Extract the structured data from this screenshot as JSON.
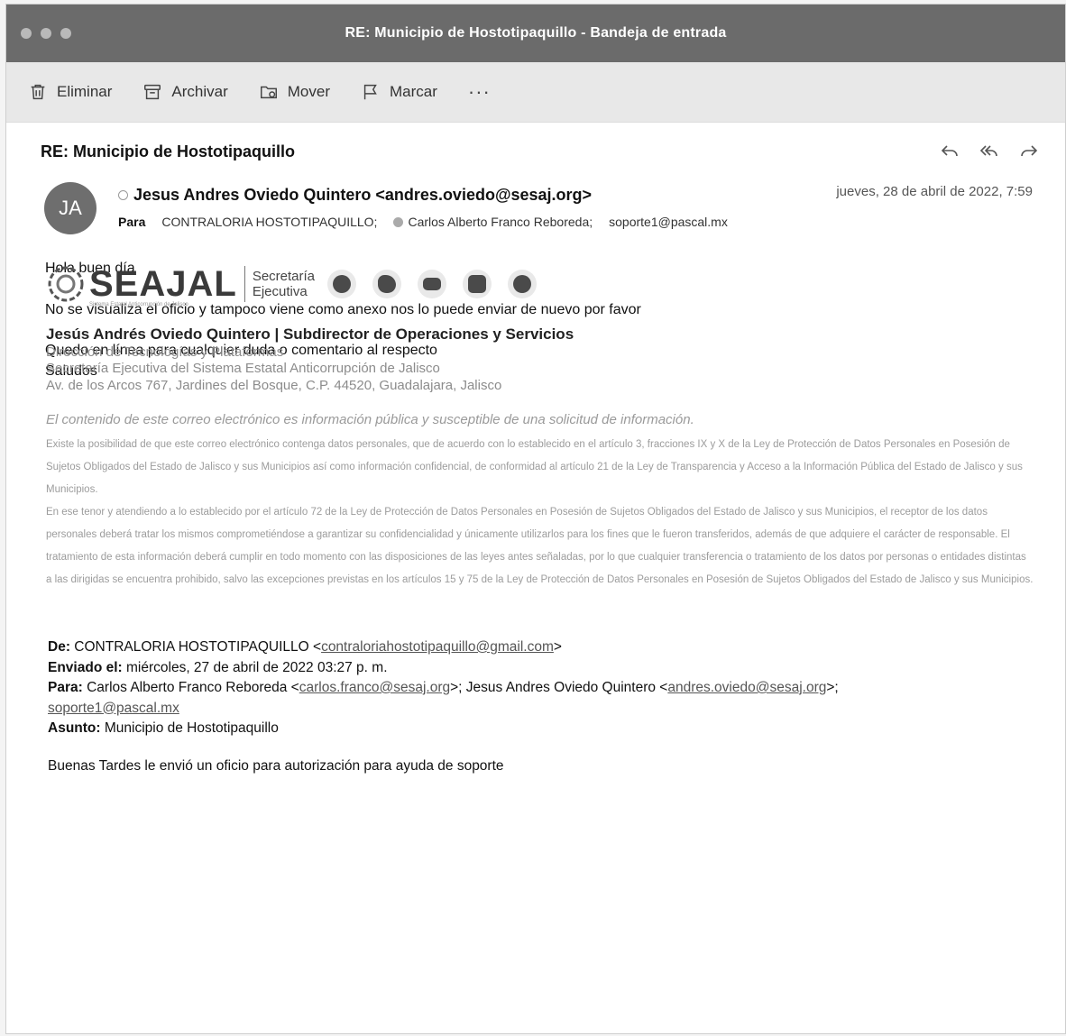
{
  "window": {
    "title": "RE: Municipio de Hostotipaquillo - Bandeja de entrada"
  },
  "toolbar": {
    "delete_label": "Eliminar",
    "archive_label": "Archivar",
    "move_label": "Mover",
    "flag_label": "Marcar",
    "more_label": "···"
  },
  "message": {
    "subject": "RE: Municipio de Hostotipaquillo",
    "avatar_initials": "JA",
    "sender": "Jesus Andres Oviedo Quintero <andres.oviedo@sesaj.org>",
    "date": "jueves, 28 de abril de 2022, 7:59",
    "to_label": "Para",
    "recipients": [
      "CONTRALORIA HOSTOTIPAQUILLO;",
      "Carlos Alberto Franco Reboreda;",
      "soporte1@pascal.mx"
    ],
    "body": [
      "Hola buen día",
      "No se visualiza el oficio y tampoco viene como anexo nos lo puede enviar de nuevo por favor",
      "Quedo en línea para cualquier duda o comentario al respecto",
      "Saludos"
    ]
  },
  "signature": {
    "logo_text": "SEAJAL",
    "logo_subtext": "Sistema Estatal Anticorrupción de Jalisco",
    "side_line1": "Secretaría",
    "side_line2": "Ejecutiva",
    "social_icons": [
      "facebook-icon",
      "twitter-icon",
      "youtube-icon",
      "instagram-icon",
      "location-icon"
    ],
    "name_title": "Jesús Andrés Oviedo Quintero | Subdirector de Operaciones y Servicios",
    "line1": "Dirección de Tecnologías y Plataformas",
    "line2": "Secretaría Ejecutiva del Sistema Estatal Anticorrupción de Jalisco",
    "line3": "Av. de los Arcos 767, Jardines del Bosque, C.P. 44520, Guadalajara, Jalisco"
  },
  "disclaimer": {
    "title": "El contenido de este correo electrónico es información pública y susceptible de una solicitud de información.",
    "p1": "Existe la posibilidad de que este correo electrónico contenga datos personales, que de acuerdo con lo establecido en el artículo 3, fracciones IX y X de la Ley de Protección de Datos Personales en Posesión de Sujetos Obligados del Estado de Jalisco y sus Municipios así como información confidencial, de conformidad al artículo 21 de la Ley de Transparencia y Acceso a la Información Pública del Estado de Jalisco y sus Municipios.",
    "p2": "En ese tenor y atendiendo a lo establecido por el artículo 72 de la Ley de Protección de Datos Personales en Posesión de Sujetos Obligados del Estado de Jalisco y sus Municipios, el receptor de los datos personales deberá tratar los mismos comprometiéndose a garantizar su confidencialidad y únicamente utilizarlos para los fines que le fueron transferidos, además de que adquiere el carácter de responsable. El tratamiento de esta información deberá cumplir en todo momento con las disposiciones de las leyes antes señaladas, por lo que cualquier transferencia o tratamiento de los datos por personas o entidades distintas a las dirigidas se encuentra prohibido, salvo las excepciones previstas en los artículos 15 y 75 de la Ley de Protección de Datos Personales en Posesión de Sujetos Obligados del Estado de Jalisco y sus Municipios."
  },
  "forwarded": {
    "from_label": "De:",
    "from_name": "CONTRALORIA HOSTOTIPAQUILLO <",
    "from_email": "contraloriahostotipaquillo@gmail.com",
    "from_close": ">",
    "sent_label": "Enviado el:",
    "sent_value": "miércoles, 27 de abril de 2022 03:27 p. m.",
    "to_label": "Para:",
    "to_name1": "Carlos Alberto Franco Reboreda <",
    "to_email1": "carlos.franco@sesaj.org",
    "to_mid": ">; Jesus Andres Oviedo Quintero <",
    "to_email2": "andres.oviedo@sesaj.org",
    "to_close": ">;",
    "to_email3": "soporte1@pascal.mx",
    "subject_label": "Asunto:",
    "subject_value": "Municipio de Hostotipaquillo",
    "body": "Buenas Tardes le envió un oficio para autorización para ayuda de soporte"
  }
}
